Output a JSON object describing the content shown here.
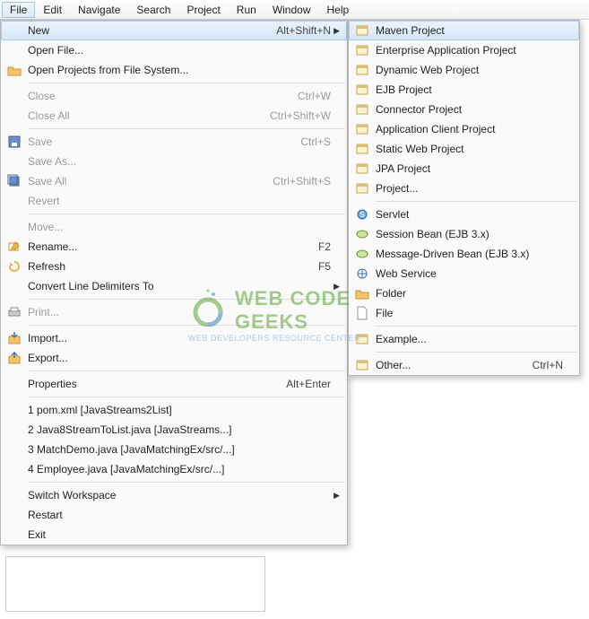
{
  "menubar": {
    "items": [
      "File",
      "Edit",
      "Navigate",
      "Search",
      "Project",
      "Run",
      "Window",
      "Help"
    ],
    "open_index": 0
  },
  "file_menu": {
    "groups": [
      [
        {
          "label": "New",
          "accel": "Alt+Shift+N",
          "arrow": true,
          "highlight": true,
          "icon": "blank"
        },
        {
          "label": "Open File...",
          "icon": "blank"
        },
        {
          "label": "Open Projects from File System...",
          "icon": "open-folder-icon"
        }
      ],
      [
        {
          "label": "Close",
          "accel": "Ctrl+W",
          "disabled": true
        },
        {
          "label": "Close All",
          "accel": "Ctrl+Shift+W",
          "disabled": true
        }
      ],
      [
        {
          "label": "Save",
          "accel": "Ctrl+S",
          "disabled": true,
          "icon": "save-icon"
        },
        {
          "label": "Save As...",
          "disabled": true
        },
        {
          "label": "Save All",
          "accel": "Ctrl+Shift+S",
          "disabled": true,
          "icon": "save-all-icon"
        },
        {
          "label": "Revert",
          "disabled": true
        }
      ],
      [
        {
          "label": "Move...",
          "disabled": true
        },
        {
          "label": "Rename...",
          "accel": "F2",
          "icon": "rename-icon"
        },
        {
          "label": "Refresh",
          "accel": "F5",
          "icon": "refresh-icon"
        },
        {
          "label": "Convert Line Delimiters To",
          "arrow": true
        }
      ],
      [
        {
          "label": "Print...",
          "disabled": true,
          "icon": "print-icon"
        }
      ],
      [
        {
          "label": "Import...",
          "icon": "import-icon"
        },
        {
          "label": "Export...",
          "icon": "export-icon"
        }
      ],
      [
        {
          "label": "Properties",
          "accel": "Alt+Enter"
        }
      ],
      [
        {
          "label": "1 pom.xml  [JavaStreams2List]"
        },
        {
          "label": "2 Java8StreamToList.java  [JavaStreams...]"
        },
        {
          "label": "3 MatchDemo.java  [JavaMatchingEx/src/...]"
        },
        {
          "label": "4 Employee.java  [JavaMatchingEx/src/...]"
        }
      ],
      [
        {
          "label": "Switch Workspace",
          "arrow": true
        },
        {
          "label": "Restart"
        },
        {
          "label": "Exit"
        }
      ]
    ]
  },
  "new_submenu": {
    "groups": [
      [
        {
          "label": "Maven Project",
          "highlight": true,
          "icon": "maven-project-icon"
        },
        {
          "label": "Enterprise Application Project",
          "icon": "ear-project-icon"
        },
        {
          "label": "Dynamic Web Project",
          "icon": "web-project-icon"
        },
        {
          "label": "EJB Project",
          "icon": "ejb-project-icon"
        },
        {
          "label": "Connector Project",
          "icon": "connector-project-icon"
        },
        {
          "label": "Application Client Project",
          "icon": "appclient-project-icon"
        },
        {
          "label": "Static Web Project",
          "icon": "static-web-icon"
        },
        {
          "label": "JPA Project",
          "icon": "jpa-project-icon"
        },
        {
          "label": "Project...",
          "icon": "project-icon"
        }
      ],
      [
        {
          "label": "Servlet",
          "icon": "servlet-icon"
        },
        {
          "label": "Session Bean (EJB 3.x)",
          "icon": "session-bean-icon"
        },
        {
          "label": "Message-Driven Bean (EJB 3.x)",
          "icon": "mdb-icon"
        },
        {
          "label": "Web Service",
          "icon": "web-service-icon"
        },
        {
          "label": "Folder",
          "icon": "folder-icon"
        },
        {
          "label": "File",
          "icon": "file-icon"
        }
      ],
      [
        {
          "label": "Example...",
          "icon": "example-icon"
        }
      ],
      [
        {
          "label": "Other...",
          "accel": "Ctrl+N",
          "icon": "other-icon"
        }
      ]
    ]
  },
  "watermark": {
    "line1": "WEB CODE GEEKS",
    "line2": "WEB DEVELOPERS RESOURCE CENTER"
  }
}
